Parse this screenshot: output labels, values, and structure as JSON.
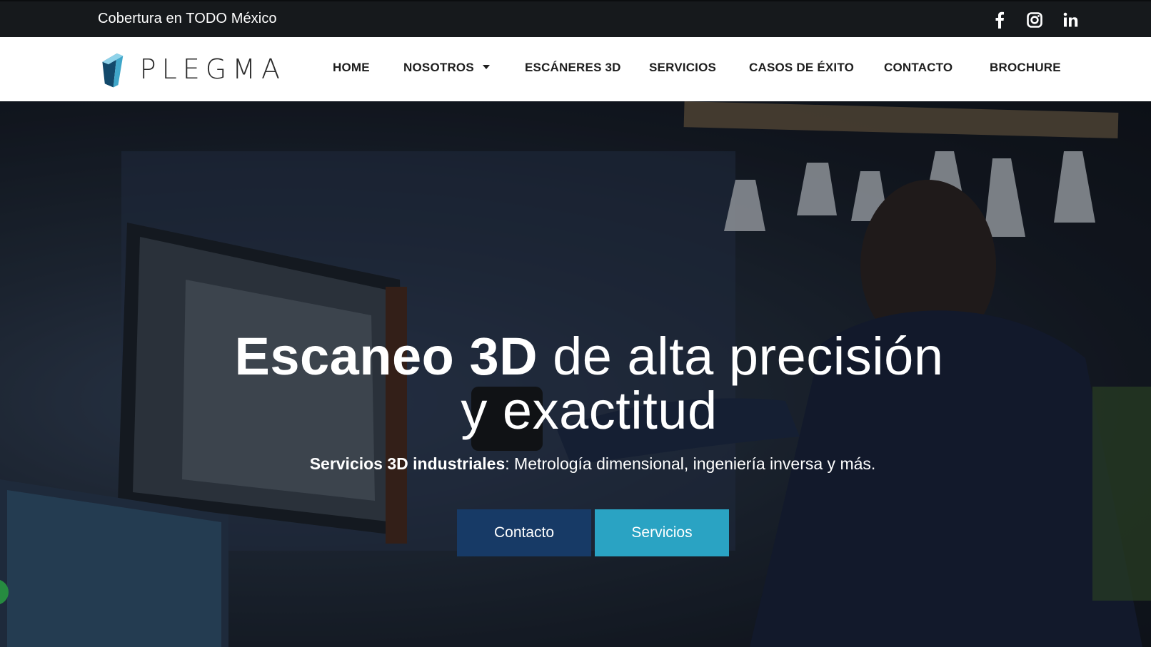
{
  "topbar": {
    "coverage_text": "Cobertura en TODO México",
    "social": [
      "facebook-icon",
      "instagram-icon",
      "linkedin-icon"
    ]
  },
  "brand": {
    "name": "PLEGMA",
    "colors": {
      "logo_dark": "#12496b",
      "logo_light": "#3fa6c9"
    }
  },
  "nav": {
    "items": [
      {
        "label": "HOME"
      },
      {
        "label": "NOSOTROS",
        "has_dropdown": true
      },
      {
        "label": "ESCÁNERES 3D"
      },
      {
        "label": "SERVICIOS"
      },
      {
        "label": "CASOS DE ÉXITO"
      },
      {
        "label": "CONTACTO"
      },
      {
        "label": "BROCHURE"
      }
    ]
  },
  "hero": {
    "headline_bold": "Escaneo 3D",
    "headline_rest": " de alta precisión",
    "headline_line2": "y exactitud",
    "sub_bold": "Servicios 3D industriales",
    "sub_rest": ": Metrología dimensional, ingeniería inversa y más.",
    "buttons": {
      "contact": "Contacto",
      "services": "Servicios"
    },
    "colors": {
      "contact_bg": "#173a66",
      "services_bg": "#2aa3c3"
    }
  }
}
